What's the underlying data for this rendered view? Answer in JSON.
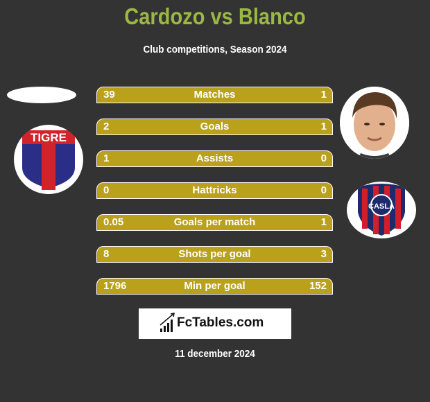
{
  "header": {
    "title": "Cardozo vs Blanco",
    "subtitle": "Club competitions, Season 2024"
  },
  "players": {
    "left": {
      "name": "Cardozo",
      "club_logo": "tigre-crest-icon",
      "club_text": "TIGRE"
    },
    "right": {
      "name": "Blanco",
      "photo": "player-photo",
      "club_logo": "san-lorenzo-crest-icon",
      "club_text": "CASLA"
    }
  },
  "stats": [
    {
      "label": "Matches",
      "left": "39",
      "right": "1"
    },
    {
      "label": "Goals",
      "left": "2",
      "right": "1"
    },
    {
      "label": "Assists",
      "left": "1",
      "right": "0"
    },
    {
      "label": "Hattricks",
      "left": "0",
      "right": "0"
    },
    {
      "label": "Goals per match",
      "left": "0.05",
      "right": "1"
    },
    {
      "label": "Shots per goal",
      "left": "8",
      "right": "3"
    },
    {
      "label": "Min per goal",
      "left": "1796",
      "right": "152"
    }
  ],
  "footer": {
    "brand": "FcTables.com",
    "date": "11 december 2024"
  },
  "colors": {
    "background": "#333333",
    "title": "#9bb843",
    "bar": "#b9a11b",
    "text": "#ffffff"
  }
}
